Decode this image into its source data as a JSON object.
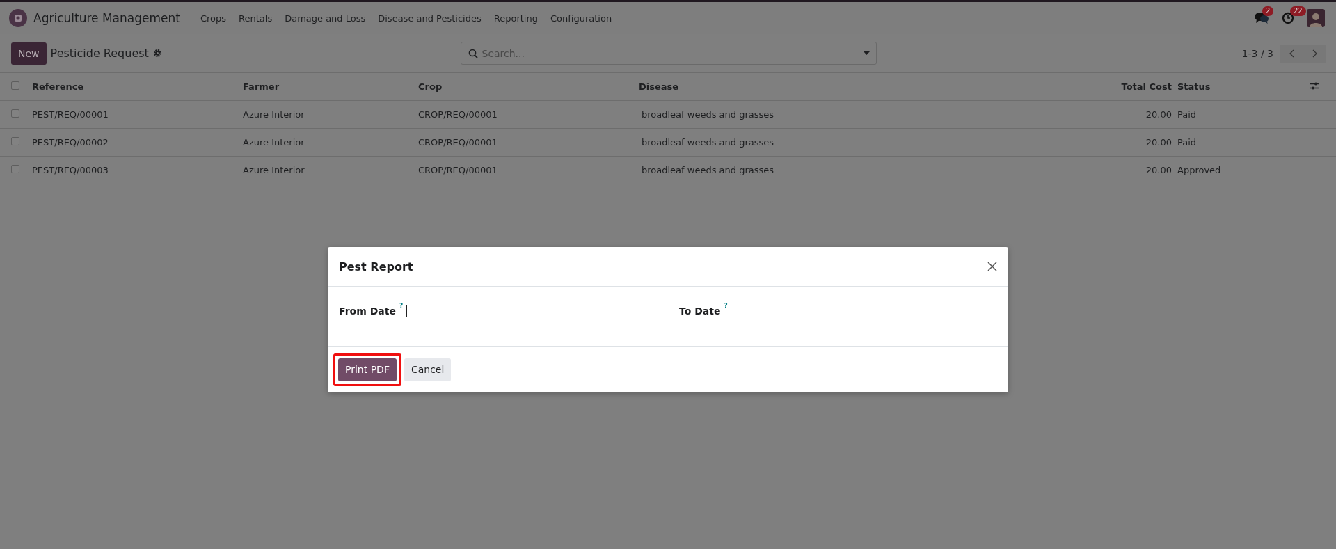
{
  "navbar": {
    "app_name": "Agriculture Management",
    "menu": [
      "Crops",
      "Rentals",
      "Damage and Loss",
      "Disease and Pesticides",
      "Reporting",
      "Configuration"
    ],
    "messages_badge": "2",
    "activities_badge": "22"
  },
  "control_panel": {
    "new_button": "New",
    "title": "Pesticide Request",
    "search": {
      "placeholder": "Search..."
    },
    "pager": "1-3 / 3"
  },
  "table": {
    "all_checked": false,
    "columns": [
      {
        "label": "Reference",
        "kind": "text"
      },
      {
        "label": "Farmer",
        "kind": "text"
      },
      {
        "label": "Crop",
        "kind": "text"
      },
      {
        "label": "Disease",
        "kind": "text"
      },
      {
        "label": "Total Cost",
        "kind": "number"
      },
      {
        "label": "Status",
        "kind": "text"
      }
    ],
    "rows": [
      {
        "checked": false,
        "cells": [
          "PEST/REQ/00001",
          "Azure Interior",
          "CROP/REQ/00001",
          "broadleaf weeds and grasses",
          "20.00",
          "Paid"
        ]
      },
      {
        "checked": false,
        "cells": [
          "PEST/REQ/00002",
          "Azure Interior",
          "CROP/REQ/00001",
          "broadleaf weeds and grasses",
          "20.00",
          "Paid"
        ]
      },
      {
        "checked": false,
        "cells": [
          "PEST/REQ/00003",
          "Azure Interior",
          "CROP/REQ/00001",
          "broadleaf weeds and grasses",
          "20.00",
          "Approved"
        ]
      }
    ]
  },
  "dialog": {
    "title": "Pest Report",
    "fields": [
      {
        "label": "From Date",
        "help_mark": "?",
        "focused": true
      },
      {
        "label": "To Date",
        "help_mark": "?",
        "focused": false
      }
    ],
    "buttons": [
      {
        "label": "Print PDF",
        "kind": "primary",
        "highlighted": true
      },
      {
        "label": "Cancel",
        "kind": "secondary",
        "highlighted": false
      }
    ]
  }
}
